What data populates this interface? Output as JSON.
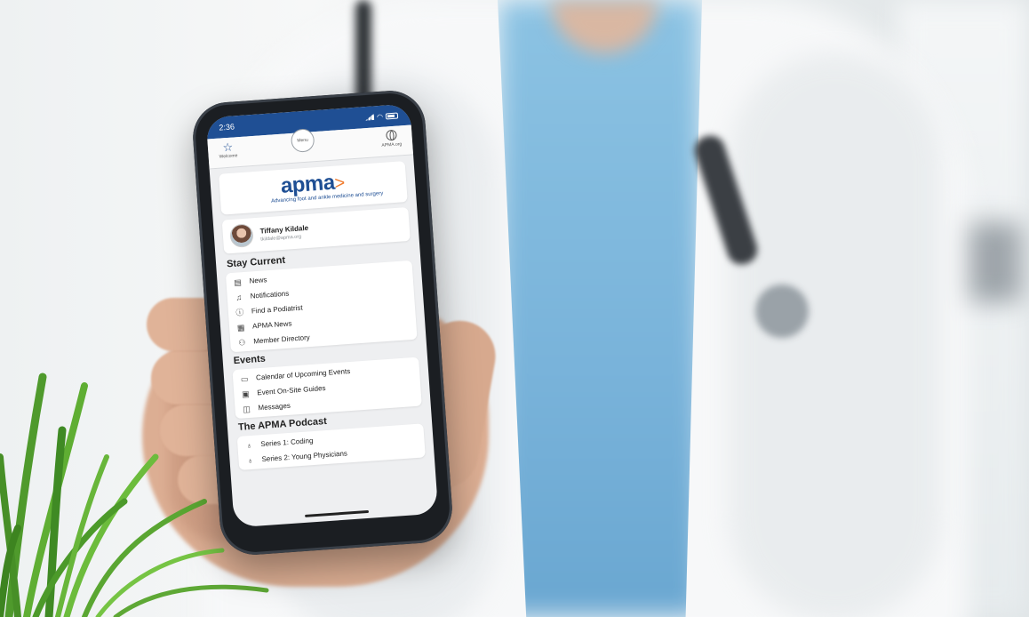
{
  "status_bar": {
    "time": "2:36"
  },
  "top_nav": {
    "welcome_label": "Welcome",
    "menu_label": "Menu",
    "site_label": "APMA.org"
  },
  "logo": {
    "word": "apma",
    "tagline": "Advancing foot and ankle medicine and surgery"
  },
  "profile": {
    "name": "Tiffany Kildale",
    "email": "tkildale@apma.org"
  },
  "sections": [
    {
      "title": "Stay Current",
      "items": [
        {
          "label": "News",
          "icon": "newspaper-icon"
        },
        {
          "label": "Notifications",
          "icon": "bell-icon"
        },
        {
          "label": "Find a Podiatrist",
          "icon": "info-icon"
        },
        {
          "label": "APMA News",
          "icon": "news-grid-icon"
        },
        {
          "label": "Member Directory",
          "icon": "people-icon"
        }
      ]
    },
    {
      "title": "Events",
      "items": [
        {
          "label": "Calendar of Upcoming Events",
          "icon": "calendar-icon"
        },
        {
          "label": "Event On-Site Guides",
          "icon": "guide-icon"
        },
        {
          "label": "Messages",
          "icon": "chat-icon"
        }
      ]
    },
    {
      "title": "The APMA Podcast",
      "items": [
        {
          "label": "Series 1: Coding",
          "icon": "microphone-icon"
        },
        {
          "label": "Series 2: Young Physicians",
          "icon": "microphone-icon"
        }
      ]
    }
  ],
  "colors": {
    "brand_blue": "#1f4f94",
    "brand_orange": "#f07a2c"
  }
}
